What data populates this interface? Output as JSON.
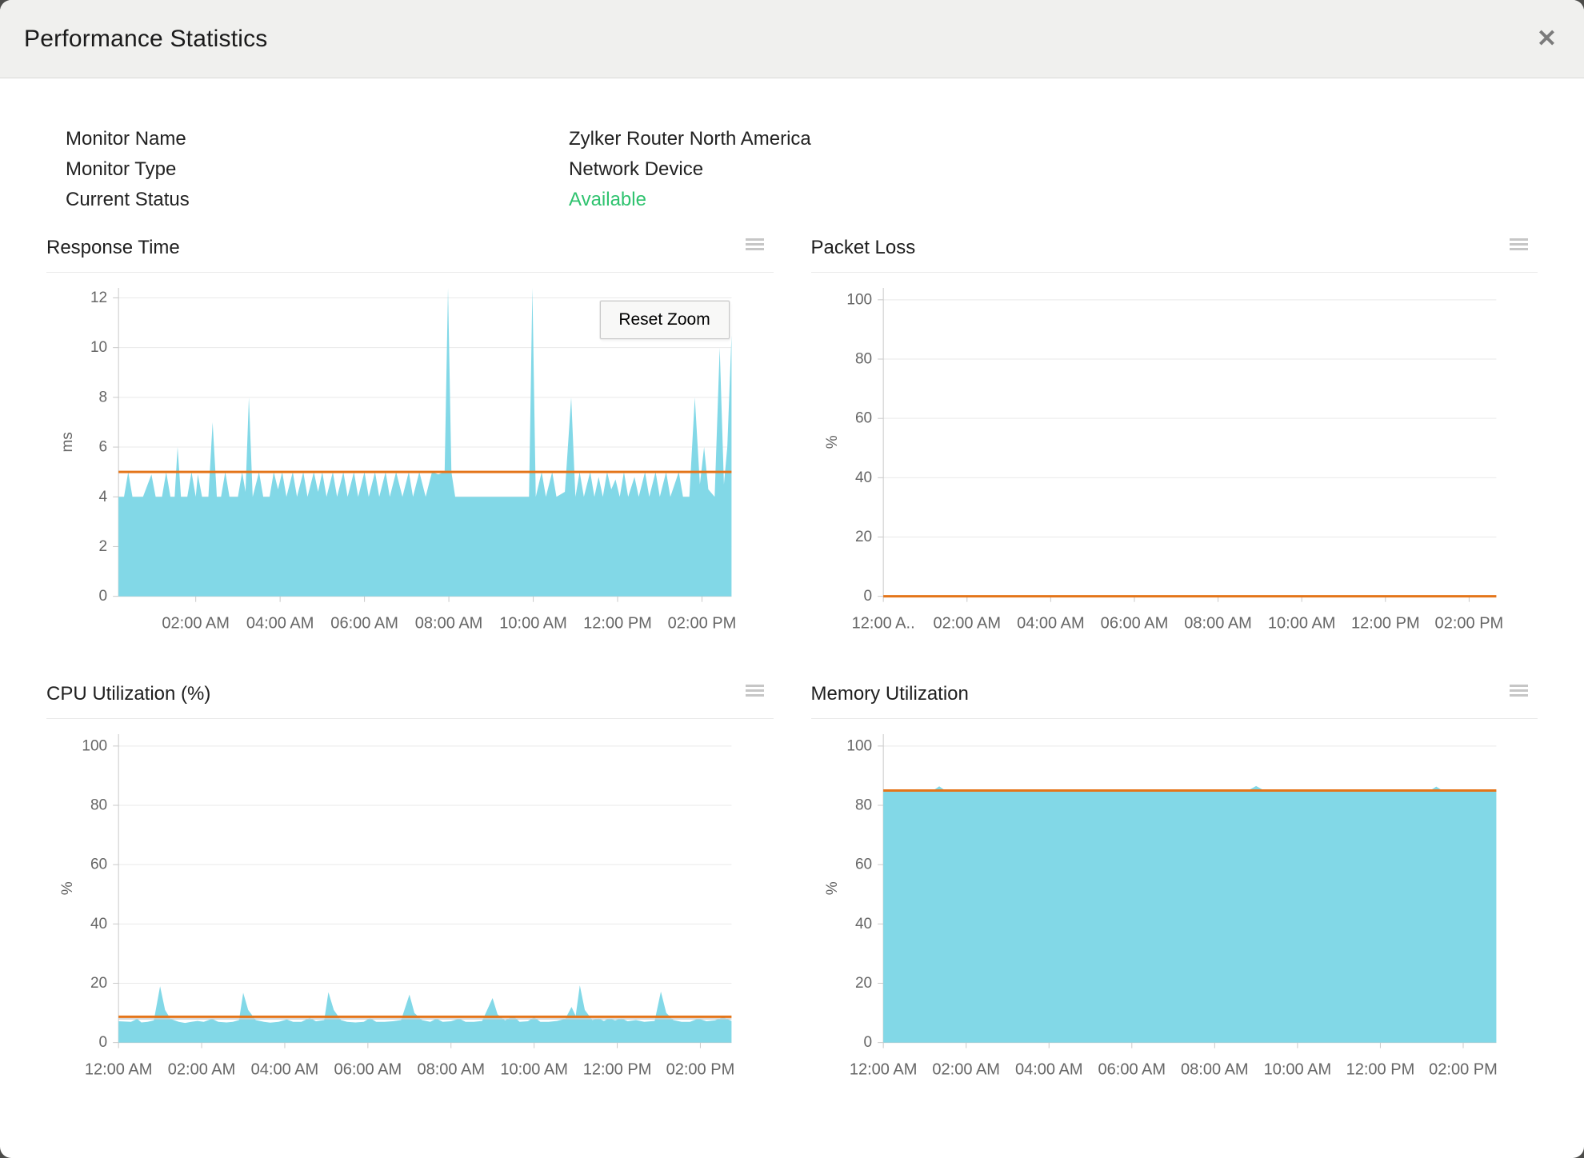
{
  "dialog": {
    "title": "Performance Statistics",
    "close_icon": "✕"
  },
  "monitor_info": {
    "rows": [
      {
        "label": "Monitor Name",
        "value": "Zylker Router North America"
      },
      {
        "label": "Monitor Type",
        "value": "Network Device"
      },
      {
        "label": "Current Status",
        "value": "Available"
      }
    ],
    "status_color": "#2fc36f"
  },
  "reset_zoom_label": "Reset Zoom",
  "colors": {
    "area_fill": "#82d8e7",
    "threshold_line": "#e4751a",
    "secondary_line": "#cccccc",
    "grid": "#e9e9e9",
    "axis": "#c9c9c9",
    "tick_text": "#666666",
    "status_green": "#2fc36f",
    "header_bg": "#f0f0ee"
  },
  "chart_data": [
    {
      "type": "area",
      "title": "Response Time",
      "ylabel": "ms",
      "ylim": [
        0,
        12.4
      ],
      "yticks": [
        0,
        2,
        4,
        6,
        8,
        10,
        12
      ],
      "xmin": 0.17,
      "xmax": 14.7,
      "xticks": [
        {
          "h": 2,
          "label": "02:00 AM"
        },
        {
          "h": 4,
          "label": "04:00 AM"
        },
        {
          "h": 6,
          "label": "06:00 AM"
        },
        {
          "h": 8,
          "label": "08:00 AM"
        },
        {
          "h": 10,
          "label": "10:00 AM"
        },
        {
          "h": 12,
          "label": "12:00 PM"
        },
        {
          "h": 14,
          "label": "02:00 PM"
        }
      ],
      "threshold": 5,
      "has_reset_zoom": true,
      "series": [
        [
          0.17,
          4
        ],
        [
          0.3,
          4
        ],
        [
          0.4,
          5
        ],
        [
          0.5,
          4
        ],
        [
          0.75,
          4
        ],
        [
          0.95,
          4.9
        ],
        [
          1.05,
          4
        ],
        [
          1.2,
          4
        ],
        [
          1.3,
          5
        ],
        [
          1.4,
          4
        ],
        [
          1.5,
          4
        ],
        [
          1.57,
          6
        ],
        [
          1.65,
          4
        ],
        [
          1.8,
          4
        ],
        [
          1.9,
          5
        ],
        [
          2.0,
          4
        ],
        [
          2.05,
          4.9
        ],
        [
          2.15,
          4
        ],
        [
          2.3,
          4
        ],
        [
          2.4,
          7
        ],
        [
          2.5,
          4
        ],
        [
          2.6,
          4
        ],
        [
          2.7,
          5
        ],
        [
          2.8,
          4
        ],
        [
          3.0,
          4
        ],
        [
          3.1,
          5
        ],
        [
          3.18,
          4.2
        ],
        [
          3.26,
          8
        ],
        [
          3.35,
          4
        ],
        [
          3.5,
          5
        ],
        [
          3.6,
          4
        ],
        [
          3.75,
          4
        ],
        [
          3.85,
          5
        ],
        [
          3.95,
          4.3
        ],
        [
          4.05,
          5
        ],
        [
          4.15,
          4
        ],
        [
          4.3,
          5
        ],
        [
          4.4,
          4
        ],
        [
          4.55,
          5
        ],
        [
          4.65,
          4
        ],
        [
          4.8,
          5
        ],
        [
          4.9,
          4.2
        ],
        [
          5.0,
          5
        ],
        [
          5.1,
          4
        ],
        [
          5.25,
          5
        ],
        [
          5.35,
          4
        ],
        [
          5.5,
          5
        ],
        [
          5.6,
          4
        ],
        [
          5.75,
          5
        ],
        [
          5.85,
          4
        ],
        [
          6.0,
          5
        ],
        [
          6.1,
          4
        ],
        [
          6.25,
          5
        ],
        [
          6.35,
          4
        ],
        [
          6.5,
          5
        ],
        [
          6.6,
          4
        ],
        [
          6.75,
          5
        ],
        [
          6.9,
          4
        ],
        [
          7.05,
          5
        ],
        [
          7.15,
          4
        ],
        [
          7.3,
          5
        ],
        [
          7.45,
          4
        ],
        [
          7.6,
          5
        ],
        [
          7.75,
          4.9
        ],
        [
          7.9,
          5
        ],
        [
          7.98,
          12.4
        ],
        [
          8.06,
          5
        ],
        [
          8.15,
          4
        ],
        [
          8.5,
          4
        ],
        [
          9.0,
          4
        ],
        [
          9.5,
          4
        ],
        [
          9.9,
          4
        ],
        [
          9.98,
          12.4
        ],
        [
          10.06,
          4
        ],
        [
          10.2,
          5
        ],
        [
          10.3,
          4
        ],
        [
          10.45,
          5
        ],
        [
          10.55,
          4
        ],
        [
          10.75,
          4.2
        ],
        [
          10.9,
          8
        ],
        [
          11.0,
          4
        ],
        [
          11.1,
          5
        ],
        [
          11.2,
          4
        ],
        [
          11.35,
          5
        ],
        [
          11.45,
          4
        ],
        [
          11.55,
          4.8
        ],
        [
          11.65,
          4
        ],
        [
          11.75,
          5
        ],
        [
          11.85,
          4.3
        ],
        [
          11.95,
          4.7
        ],
        [
          12.05,
          4
        ],
        [
          12.15,
          5
        ],
        [
          12.25,
          4
        ],
        [
          12.4,
          4.8
        ],
        [
          12.5,
          4
        ],
        [
          12.65,
          5
        ],
        [
          12.75,
          4
        ],
        [
          12.9,
          5
        ],
        [
          13.0,
          4
        ],
        [
          13.15,
          5
        ],
        [
          13.25,
          4
        ],
        [
          13.45,
          5
        ],
        [
          13.55,
          4
        ],
        [
          13.7,
          4
        ],
        [
          13.83,
          8
        ],
        [
          13.95,
          4.5
        ],
        [
          14.05,
          6
        ],
        [
          14.15,
          4.3
        ],
        [
          14.3,
          4
        ],
        [
          14.42,
          10
        ],
        [
          14.52,
          4.5
        ],
        [
          14.6,
          6
        ],
        [
          14.7,
          10.5
        ]
      ]
    },
    {
      "type": "area",
      "title": "Packet Loss",
      "ylabel": "%",
      "ylim": [
        0,
        104
      ],
      "yticks": [
        0,
        20,
        40,
        60,
        80,
        100
      ],
      "xmin": 0,
      "xmax": 14.65,
      "xticks": [
        {
          "h": 0,
          "label": "12:00 A.."
        },
        {
          "h": 2,
          "label": "02:00 AM"
        },
        {
          "h": 4,
          "label": "04:00 AM"
        },
        {
          "h": 6,
          "label": "06:00 AM"
        },
        {
          "h": 8,
          "label": "08:00 AM"
        },
        {
          "h": 10,
          "label": "10:00 AM"
        },
        {
          "h": 12,
          "label": "12:00 PM"
        },
        {
          "h": 14,
          "label": "02:00 PM"
        }
      ],
      "threshold": 0,
      "has_reset_zoom": false,
      "series": [
        [
          0,
          0
        ],
        [
          14.65,
          0
        ]
      ]
    },
    {
      "type": "area",
      "title": "CPU Utilization (%)",
      "ylabel": "%",
      "ylim": [
        0,
        104
      ],
      "yticks": [
        0,
        20,
        40,
        60,
        80,
        100
      ],
      "xmin": 0,
      "xmax": 14.75,
      "xticks": [
        {
          "h": 0,
          "label": "12:00 AM"
        },
        {
          "h": 2,
          "label": "02:00 AM"
        },
        {
          "h": 4,
          "label": "04:00 AM"
        },
        {
          "h": 6,
          "label": "06:00 AM"
        },
        {
          "h": 8,
          "label": "08:00 AM"
        },
        {
          "h": 10,
          "label": "10:00 AM"
        },
        {
          "h": 12,
          "label": "12:00 PM"
        },
        {
          "h": 14,
          "label": "02:00 PM"
        }
      ],
      "threshold": 8.7,
      "secondary": 8,
      "has_reset_zoom": false,
      "series": [
        [
          0,
          7.2
        ],
        [
          0.3,
          7
        ],
        [
          0.45,
          8
        ],
        [
          0.55,
          6.8
        ],
        [
          0.7,
          7
        ],
        [
          0.85,
          7.5
        ],
        [
          1.0,
          19
        ],
        [
          1.12,
          11
        ],
        [
          1.25,
          8
        ],
        [
          1.45,
          7
        ],
        [
          1.6,
          6.6
        ],
        [
          1.75,
          7
        ],
        [
          1.9,
          7.3
        ],
        [
          2.05,
          7
        ],
        [
          2.25,
          8
        ],
        [
          2.4,
          7
        ],
        [
          2.6,
          6.8
        ],
        [
          2.75,
          7
        ],
        [
          2.9,
          7.6
        ],
        [
          3.0,
          16.8
        ],
        [
          3.12,
          11
        ],
        [
          3.3,
          7.6
        ],
        [
          3.5,
          7
        ],
        [
          3.65,
          6.7
        ],
        [
          3.85,
          7
        ],
        [
          4.05,
          7.8
        ],
        [
          4.2,
          7
        ],
        [
          4.4,
          7
        ],
        [
          4.6,
          8.4
        ],
        [
          4.75,
          7.2
        ],
        [
          4.95,
          7.6
        ],
        [
          5.05,
          17
        ],
        [
          5.18,
          11
        ],
        [
          5.35,
          7.6
        ],
        [
          5.5,
          7
        ],
        [
          5.7,
          6.8
        ],
        [
          5.9,
          7
        ],
        [
          6.05,
          8.3
        ],
        [
          6.2,
          7
        ],
        [
          6.4,
          7
        ],
        [
          6.6,
          7.2
        ],
        [
          6.8,
          7.6
        ],
        [
          7.0,
          16.2
        ],
        [
          7.12,
          10
        ],
        [
          7.3,
          7.6
        ],
        [
          7.5,
          7
        ],
        [
          7.65,
          8.1
        ],
        [
          7.8,
          7
        ],
        [
          8.0,
          7.2
        ],
        [
          8.2,
          8.1
        ],
        [
          8.35,
          7
        ],
        [
          8.55,
          7
        ],
        [
          8.75,
          7.3
        ],
        [
          9.0,
          15
        ],
        [
          9.12,
          9.5
        ],
        [
          9.3,
          7.5
        ],
        [
          9.5,
          9
        ],
        [
          9.65,
          7
        ],
        [
          9.85,
          7.2
        ],
        [
          10.0,
          8.6
        ],
        [
          10.15,
          7
        ],
        [
          10.35,
          7
        ],
        [
          10.55,
          7.3
        ],
        [
          10.75,
          8
        ],
        [
          10.9,
          12
        ],
        [
          11.0,
          9
        ],
        [
          11.1,
          19.3
        ],
        [
          11.22,
          11
        ],
        [
          11.4,
          7.6
        ],
        [
          11.55,
          8.2
        ],
        [
          11.68,
          7.3
        ],
        [
          11.8,
          8.2
        ],
        [
          11.95,
          7.5
        ],
        [
          12.1,
          8.2
        ],
        [
          12.25,
          7.2
        ],
        [
          12.45,
          7.6
        ],
        [
          12.65,
          7
        ],
        [
          12.9,
          7.3
        ],
        [
          13.05,
          17.2
        ],
        [
          13.18,
          10
        ],
        [
          13.35,
          7.6
        ],
        [
          13.55,
          7
        ],
        [
          13.75,
          7
        ],
        [
          13.95,
          8.1
        ],
        [
          14.15,
          7.2
        ],
        [
          14.35,
          7.5
        ],
        [
          14.55,
          8.6
        ],
        [
          14.75,
          7.3
        ]
      ]
    },
    {
      "type": "area",
      "title": "Memory Utilization",
      "ylabel": "%",
      "ylim": [
        0,
        104
      ],
      "yticks": [
        0,
        20,
        40,
        60,
        80,
        100
      ],
      "xmin": 0,
      "xmax": 14.8,
      "xticks": [
        {
          "h": 0,
          "label": "12:00 AM"
        },
        {
          "h": 2,
          "label": "02:00 AM"
        },
        {
          "h": 4,
          "label": "04:00 AM"
        },
        {
          "h": 6,
          "label": "06:00 AM"
        },
        {
          "h": 8,
          "label": "08:00 AM"
        },
        {
          "h": 10,
          "label": "10:00 AM"
        },
        {
          "h": 12,
          "label": "12:00 PM"
        },
        {
          "h": 14,
          "label": "02:00 PM"
        }
      ],
      "threshold": 85,
      "has_reset_zoom": false,
      "series": [
        [
          0,
          85
        ],
        [
          1.2,
          85
        ],
        [
          1.35,
          86.4
        ],
        [
          1.5,
          85
        ],
        [
          4.0,
          85
        ],
        [
          8.8,
          85
        ],
        [
          9.0,
          86.5
        ],
        [
          9.2,
          85
        ],
        [
          13.2,
          85
        ],
        [
          13.35,
          86.3
        ],
        [
          13.5,
          85
        ],
        [
          14.8,
          85
        ]
      ]
    }
  ]
}
